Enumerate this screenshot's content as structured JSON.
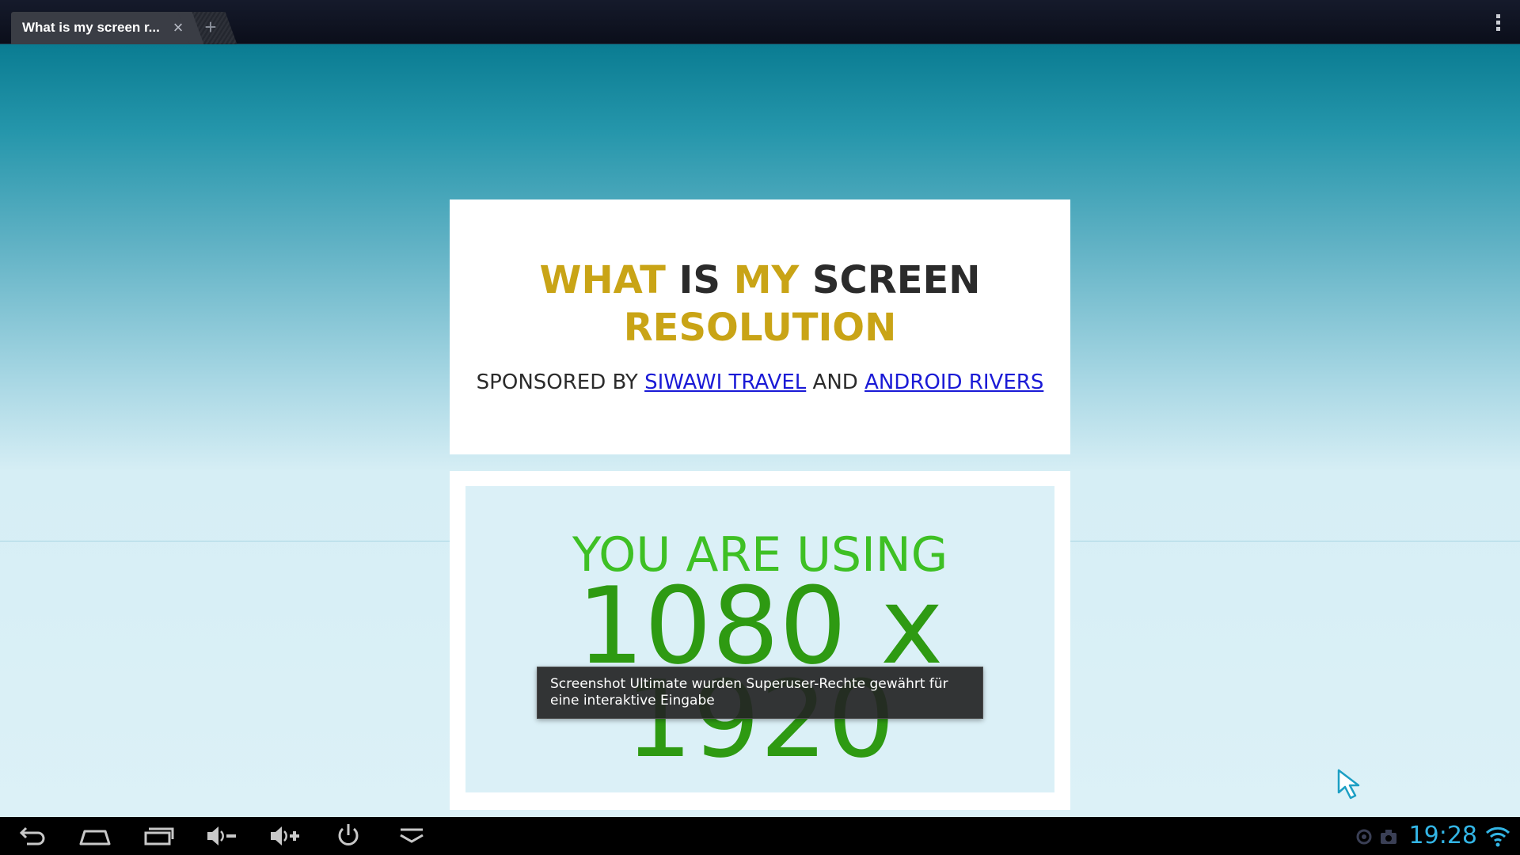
{
  "browser": {
    "tab_title": "What is my screen r...",
    "close_symbol": "×",
    "new_tab_symbol": "+"
  },
  "page": {
    "headline": {
      "what": "WHAT",
      "is": "IS",
      "my": "MY",
      "screen": "SCREEN",
      "resolution": "RESOLUTION"
    },
    "sponsor": {
      "prefix": "SPONSORED BY",
      "link1": "SIWAWI TRAVEL",
      "and": "AND",
      "link2": "ANDROID RIVERS"
    },
    "result": {
      "label": "YOU ARE USING",
      "width_value": "1080",
      "separator": "x",
      "height_value": "1920"
    }
  },
  "toast": {
    "message": "Screenshot Ultimate wurden Superuser-Rechte gewährt für eine interaktive Eingabe"
  },
  "system_bar": {
    "clock": "19:28"
  },
  "colors": {
    "headline_gold": "#c9a416",
    "headline_dark": "#2b2b2b",
    "link_blue": "#1a1ad6",
    "label_green": "#3ec024",
    "value_green": "#2e9a12",
    "clock_blue": "#33b5e5"
  },
  "icons": {
    "nav": [
      "back-icon",
      "home-icon",
      "recent-apps-icon",
      "volume-down-icon",
      "volume-up-icon",
      "power-icon",
      "collapse-icon"
    ],
    "status": [
      "notification-icon",
      "screenshot-icon",
      "wifi-icon"
    ],
    "browser": [
      "tab-close-icon",
      "new-tab-icon",
      "overflow-menu-icon"
    ],
    "pointer": "mouse-cursor-icon"
  }
}
